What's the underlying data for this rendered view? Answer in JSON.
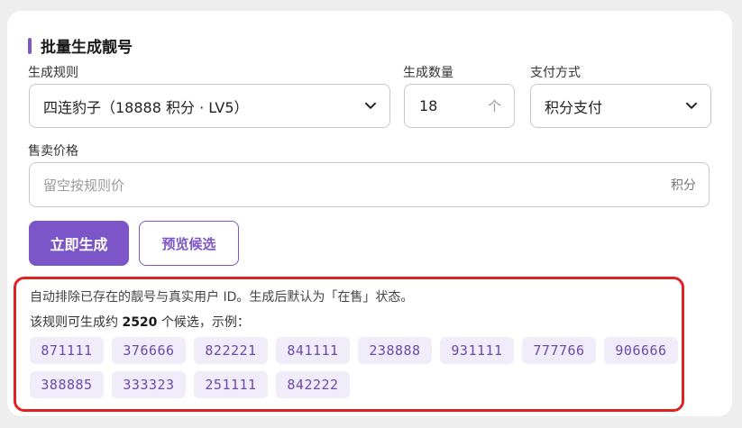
{
  "panel": {
    "title": "批量生成靓号"
  },
  "form": {
    "rule_label": "生成规则",
    "rule_value": "四连豹子（18888 积分 · LV5）",
    "count_label": "生成数量",
    "count_value": "18",
    "count_unit": "个",
    "payment_label": "支付方式",
    "payment_value": "积分支付",
    "price_label": "售卖价格",
    "price_placeholder": "留空按规则价",
    "price_unit": "积分"
  },
  "actions": {
    "generate_label": "立即生成",
    "preview_label": "预览候选"
  },
  "info": {
    "note": "自动排除已存在的靓号与真实用户 ID。生成后默认为「在售」状态。",
    "count_prefix": "该规则可生成约 ",
    "count_value": "2520",
    "count_suffix": " 个候选，示例：",
    "examples": [
      "871111",
      "376666",
      "822221",
      "841111",
      "238888",
      "931111",
      "777766",
      "906666",
      "388885",
      "333323",
      "251111",
      "842222"
    ]
  },
  "colors": {
    "accent": "#7c55c8",
    "highlight_border": "#e02222",
    "chip_bg": "#f1ecfa"
  }
}
